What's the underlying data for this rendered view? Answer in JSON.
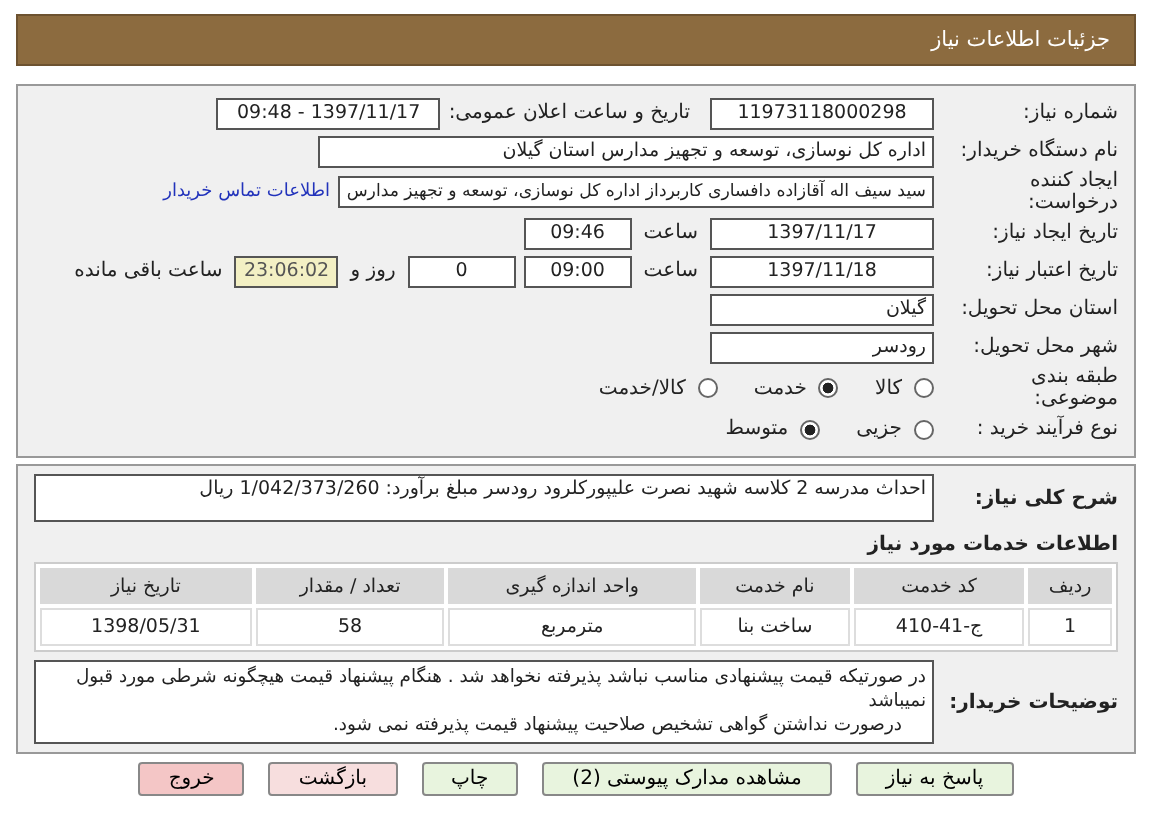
{
  "header": {
    "title": "جزئیات اطلاعات نیاز"
  },
  "details": {
    "need_number_label": "شماره نیاز:",
    "need_number": "11973118000298",
    "announce_label": "تاریخ و ساعت اعلان عمومی:",
    "announce_value": "1397/11/17 - 09:48",
    "buyer_label": "نام دستگاه خریدار:",
    "buyer": "اداره کل نوسازی، توسعه و تجهیز مدارس استان گیلان",
    "creator_label": "ایجاد کننده درخواست:",
    "creator": "سید سیف اله آقازاده دافساری کاربرداز اداره کل نوسازی، توسعه و تجهیز مدارس",
    "contact_link": "اطلاعات تماس خریدار",
    "created_label": "تاریخ ایجاد نیاز:",
    "created_date": "1397/11/17",
    "created_time_label": "ساعت",
    "created_time": "09:46",
    "validity_label": "تاریخ اعتبار نیاز:",
    "validity_date": "1397/11/18",
    "validity_time_label": "ساعت",
    "validity_time": "09:00",
    "days": "0",
    "days_label": "روز و",
    "remaining": "23:06:02",
    "remaining_label": "ساعت باقی مانده",
    "province_label": "استان محل تحویل:",
    "province": "گیلان",
    "city_label": "شهر محل تحویل:",
    "city": "رودسر",
    "category_label": "طبقه بندی موضوعی:",
    "category_options": [
      {
        "label": "کالا",
        "selected": false
      },
      {
        "label": "خدمت",
        "selected": true
      },
      {
        "label": "کالا/خدمت",
        "selected": false
      }
    ],
    "process_label": "نوع فرآیند خرید :",
    "process_options": [
      {
        "label": "جزیی",
        "selected": false
      },
      {
        "label": "متوسط",
        "selected": true
      }
    ]
  },
  "description": {
    "label": "شرح کلی نیاز:",
    "text": "احداث مدرسه 2 کلاسه شهید نصرت علیپورکلرود رودسر  مبلغ برآورد: 1/042/373/260 ریال"
  },
  "services": {
    "title": "اطلاعات خدمات مورد نیاز",
    "columns": [
      "ردیف",
      "کد خدمت",
      "نام خدمت",
      "واحد اندازه گیری",
      "تعداد / مقدار",
      "تاریخ نیاز"
    ],
    "rows": [
      [
        "1",
        "ج-41-410",
        "ساخت بنا",
        "مترمربع",
        "58",
        "1398/05/31"
      ]
    ]
  },
  "notes": {
    "label": "توضیحات خریدار:",
    "lines": [
      "در صورتیکه قیمت پیشنهادی مناسب نباشد پذیرفته نخواهد شد . هنگام پیشنهاد قیمت هیچگونه شرطی مورد قبول نمیباشد",
      "درصورت نداشتن گواهی تشخیص صلاحیت پیشنهاد قیمت پذیرفته نمی شود."
    ]
  },
  "buttons": [
    {
      "label": "پاسخ به نیاز",
      "kind": "normal"
    },
    {
      "label": "مشاهده مدارک پیوستی (2)",
      "kind": "normal"
    },
    {
      "label": "چاپ",
      "kind": "normal"
    },
    {
      "label": "بازگشت",
      "kind": "back"
    },
    {
      "label": "خروج",
      "kind": "exit"
    }
  ]
}
